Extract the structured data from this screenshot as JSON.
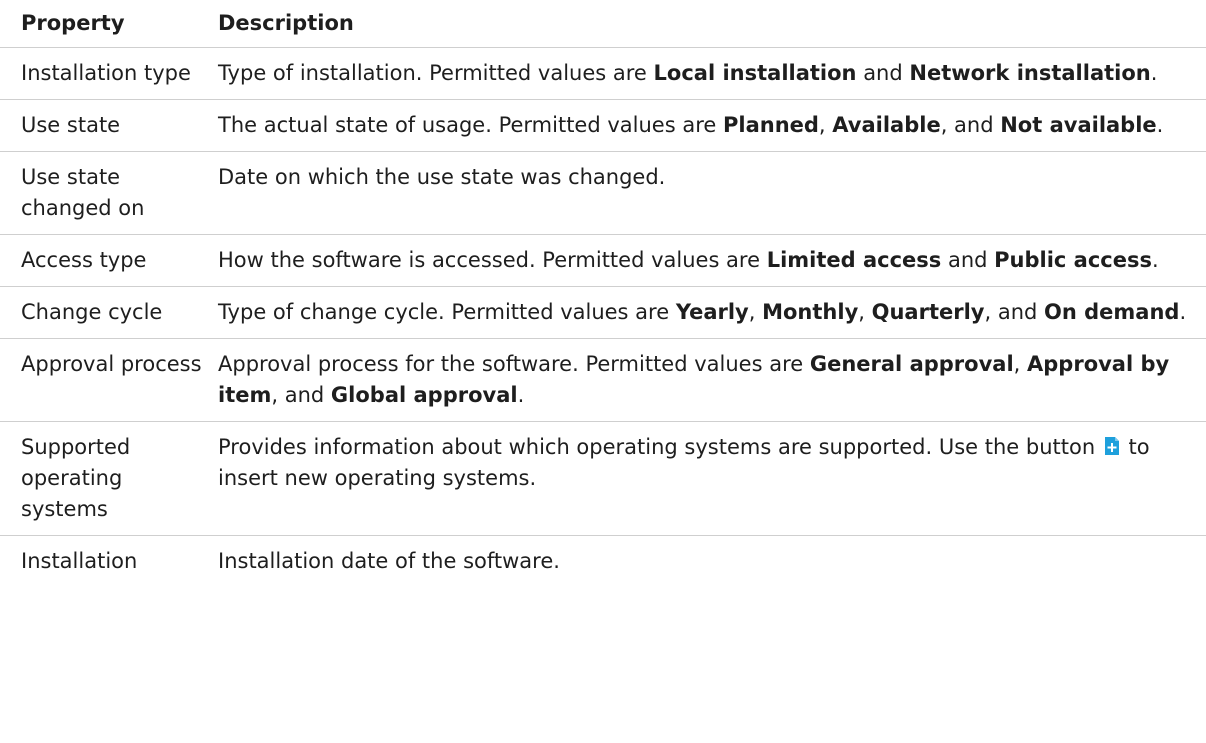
{
  "header": {
    "property": "Property",
    "description": "Description"
  },
  "rows": [
    {
      "property": "Installation type",
      "parts": [
        {
          "text": "Type of installation. Permitted values are "
        },
        {
          "text": "Local installation",
          "bold": true
        },
        {
          "text": " and "
        },
        {
          "text": "Network installation",
          "bold": true
        },
        {
          "text": "."
        }
      ]
    },
    {
      "property": "Use state",
      "parts": [
        {
          "text": "The actual state of usage. Permitted values are "
        },
        {
          "text": "Planned",
          "bold": true
        },
        {
          "text": ", "
        },
        {
          "text": "Available",
          "bold": true
        },
        {
          "text": ", and "
        },
        {
          "text": "Not available",
          "bold": true
        },
        {
          "text": "."
        }
      ]
    },
    {
      "property": "Use state changed on",
      "parts": [
        {
          "text": "Date on which the use state was changed."
        }
      ]
    },
    {
      "property": "Access type",
      "parts": [
        {
          "text": "How the software is accessed. Permitted values are "
        },
        {
          "text": "Limited access",
          "bold": true
        },
        {
          "text": " and "
        },
        {
          "text": "Public access",
          "bold": true
        },
        {
          "text": "."
        }
      ]
    },
    {
      "property": "Change cycle",
      "parts": [
        {
          "text": "Type of change cycle. Permitted values are "
        },
        {
          "text": "Yearly",
          "bold": true
        },
        {
          "text": ", "
        },
        {
          "text": "Monthly",
          "bold": true
        },
        {
          "text": ", "
        },
        {
          "text": "Quarterly",
          "bold": true
        },
        {
          "text": ", and "
        },
        {
          "text": "On demand",
          "bold": true
        },
        {
          "text": "."
        }
      ]
    },
    {
      "property": "Approval process",
      "parts": [
        {
          "text": "Approval process for the software. Permitted values are "
        },
        {
          "text": "General approval",
          "bold": true
        },
        {
          "text": ", "
        },
        {
          "text": "Approval by item",
          "bold": true
        },
        {
          "text": ", and "
        },
        {
          "text": "Global approval",
          "bold": true
        },
        {
          "text": "."
        }
      ]
    },
    {
      "property": "Supported operating systems",
      "parts": [
        {
          "text": "Provides information about which operating systems are supported. Use the button "
        },
        {
          "icon": "insert-document-plus-icon"
        },
        {
          "text": " to insert new operating systems."
        }
      ]
    },
    {
      "property": "Installation",
      "parts": [
        {
          "text": "Installation date of the software."
        }
      ]
    }
  ],
  "colors": {
    "text": "#1e1e1e",
    "divider": "#cfcfcf",
    "icon_fill": "#1ea0dc"
  }
}
